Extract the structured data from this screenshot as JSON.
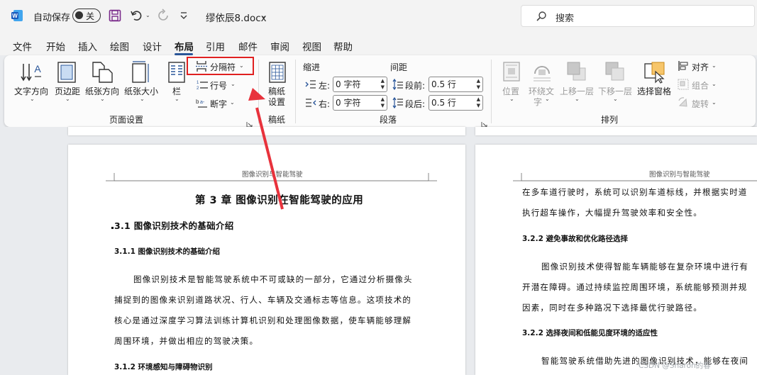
{
  "title_bar": {
    "app_icon": "word-icon",
    "autosave_label": "自动保存",
    "autosave_state": "关",
    "doc_name": "缪依辰8.docx",
    "search_placeholder": "搜索"
  },
  "menu": {
    "items": [
      "文件",
      "开始",
      "插入",
      "绘图",
      "设计",
      "布局",
      "引用",
      "邮件",
      "审阅",
      "视图",
      "帮助"
    ],
    "active": "布局"
  },
  "ribbon": {
    "page_setup": {
      "group_label": "页面设置",
      "text_direction": "文字方向",
      "margins": "页边距",
      "orientation": "纸张方向",
      "size": "纸张大小",
      "columns": "栏",
      "breaks": "分隔符",
      "line_numbers": "行号",
      "hyphenation": "断字"
    },
    "manuscript": {
      "group_label": "稿纸",
      "setting_line1": "稿纸",
      "setting_line2": "设置"
    },
    "paragraph": {
      "group_label": "段落",
      "indent_label": "缩进",
      "spacing_label": "间距",
      "left_label": "左:",
      "left_value": "0 字符",
      "right_label": "右:",
      "right_value": "0 字符",
      "before_label": "段前:",
      "before_value": "0.5 行",
      "after_label": "段后:",
      "after_value": "0.5 行"
    },
    "arrange": {
      "group_label": "排列",
      "position": "位置",
      "wrap_line1": "环绕文",
      "wrap_line2": "字",
      "bring_forward": "上移一层",
      "send_backward": "下移一层",
      "selection_pane": "选择窗格",
      "align": "对齐",
      "group": "组合",
      "rotate": "旋转"
    }
  },
  "document": {
    "header_text": "图像识别与智能驾驶",
    "left_page": {
      "chapter_title": "第 3 章  图像识别在智能驾驶的应用",
      "section_title": "3.1 图像识别技术的基础介绍",
      "subsection_1": "3.1.1 图像识别技术的基础介绍",
      "para_lines": [
        "图像识别技术是智能驾驶系统中不可或缺的一部分，它通过分析摄像头",
        "捕捉到的图像来识别道路状况、行人、车辆及交通标志等信息。这项技术的",
        "核心是通过深度学习算法训练计算机识别和处理图像数据，使车辆能够理解",
        "周围环境，并做出相应的驾驶决策。"
      ],
      "subsection_2": "3.1.2 环境感知与障碍物识别"
    },
    "right_page": {
      "line_1": "在多车道行驶时，系统可以识别车道标线，并根据实时道",
      "line_2": "执行超车操作，大幅提升驾驶效率和安全性。",
      "subsection_1": "3.2.2 避免事故和优化路径选择",
      "para_lines": [
        "图像识别技术使得智能车辆能够在复杂环境中进行有",
        "开潜在障碍。通过持续监控周围环境，系统能够预测并规",
        "因素，同时在多种路况下选择最优行驶路径。"
      ],
      "subsection_2": "3.2.2 选择夜间和低能见度环境的适应性",
      "last_line": "智能驾驶系统借助先进的图像识别技术，能够在夜间"
    },
    "watermark": "CSDN @Sharon的春"
  },
  "colors": {
    "accent": "#2b579a",
    "highlight_box": "#e02020",
    "arrow": "#e8323c"
  }
}
